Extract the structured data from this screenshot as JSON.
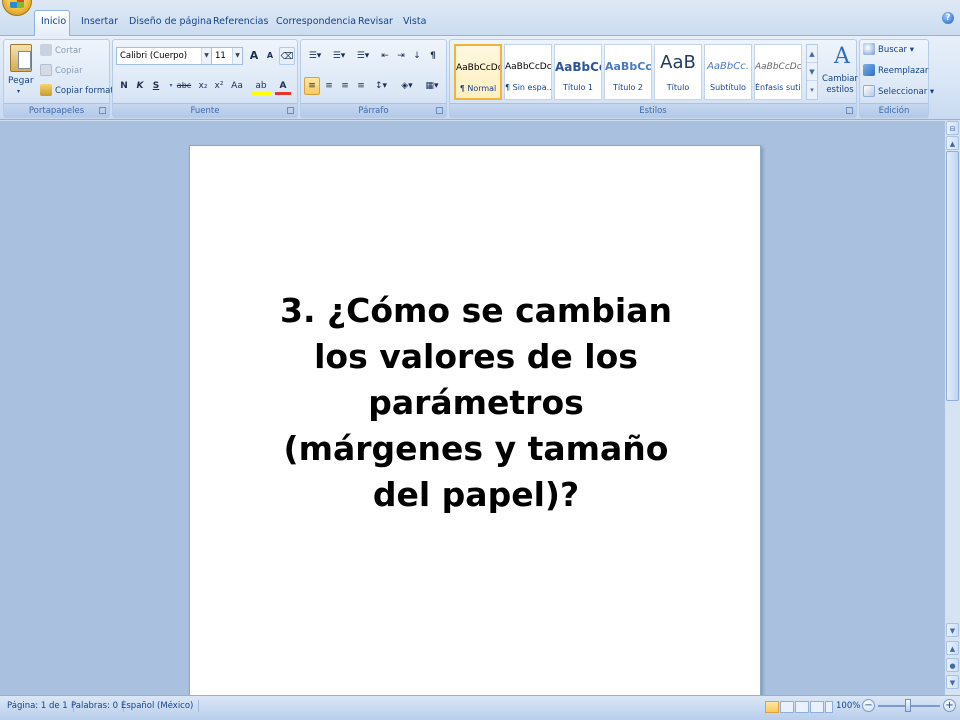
{
  "tabs": [
    "Inicio",
    "Insertar",
    "Diseño de página",
    "Referencias",
    "Correspondencia",
    "Revisar",
    "Vista"
  ],
  "clipboard": {
    "paste": "Pegar",
    "cut": "Cortar",
    "copy": "Copiar",
    "format_painter": "Copiar formato",
    "label": "Portapapeles"
  },
  "font": {
    "name": "Calibri (Cuerpo)",
    "size": "11",
    "label": "Fuente",
    "bold": "N",
    "italic": "K",
    "underline": "S",
    "strike": "abc",
    "subscript": "x₂",
    "superscript": "x²",
    "case": "Aa",
    "grow": "A",
    "shrink": "A",
    "highlight": "ab",
    "color": "A"
  },
  "paragraph": {
    "label": "Párrafo",
    "pilcrow": "¶"
  },
  "styles": {
    "label": "Estilos",
    "items": [
      {
        "sample": "AaBbCcDc",
        "name": "¶ Normal"
      },
      {
        "sample": "AaBbCcDc",
        "name": "¶ Sin espa..."
      },
      {
        "sample": "AaBbCc",
        "name": "Título 1"
      },
      {
        "sample": "AaBbCc",
        "name": "Título 2"
      },
      {
        "sample": "AaB",
        "name": "Título"
      },
      {
        "sample": "AaBbCc.",
        "name": "Subtítulo"
      },
      {
        "sample": "AaBbCcDc",
        "name": "Énfasis sutil"
      }
    ],
    "change_styles_line1": "Cambiar",
    "change_styles_line2": "estilos"
  },
  "editing": {
    "label": "Edición",
    "find": "Buscar",
    "replace": "Reemplazar",
    "select": "Seleccionar"
  },
  "document": {
    "lines": [
      "3. ¿Cómo se cambian",
      "los valores de los",
      "parámetros",
      "(márgenes y tamaño",
      "del papel)?"
    ]
  },
  "status": {
    "page": "Página: 1 de 1",
    "words": "Palabras: 0",
    "language": "Español (México)",
    "zoom": "100%"
  },
  "colors": {
    "ribbon": "#dbe7f6",
    "workspace": "#a9c0df",
    "accent": "#15428b"
  }
}
